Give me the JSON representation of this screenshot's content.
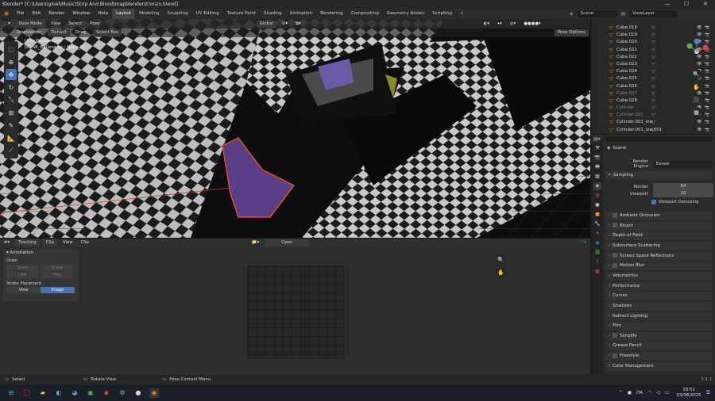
{
  "window": {
    "title": "Blender* [C:\\Users\\gioel\\Music\\Strip And Blood\\mapblenderstronzo.blend]",
    "controls": [
      "—",
      "☐",
      "✕"
    ]
  },
  "menu": {
    "items": [
      "File",
      "Edit",
      "Render",
      "Window",
      "Help"
    ],
    "workspaces": [
      "Layout",
      "Modeling",
      "Sculpting",
      "UV Editing",
      "Texture Paint",
      "Shading",
      "Animation",
      "Rendering",
      "Compositing",
      "Geometry Nodes",
      "Scripting",
      "+"
    ],
    "scene": "Scene",
    "view_layer": "ViewLayer"
  },
  "viewport": {
    "mode": "Pose Mode",
    "menus": [
      "View",
      "Select",
      "Pose"
    ],
    "transform": "Global",
    "orientation_label": "Orientation:",
    "orientation_value": "Default",
    "drag_label": "Drag:",
    "drag_value": "Select Box",
    "pose_options": "Pose Options",
    "perspective": "User Perspective",
    "object_info": "(0) SK_Ballora.ao : Neck_fh"
  },
  "clip": {
    "mode": "Tracking",
    "view_mode": "Clip",
    "menus": [
      "View",
      "Clip"
    ],
    "open": "Open",
    "annotation": {
      "title": "Annotation",
      "draw_label": "Draw:",
      "tools": [
        "Draw",
        "Erase",
        "Line",
        "Poly"
      ],
      "stroke_label": "Stroke Placement:",
      "view": "View",
      "image": "Image"
    }
  },
  "outliner": {
    "items": [
      {
        "name": "Cube.018",
        "dim": false
      },
      {
        "name": "Cube.019",
        "dim": false
      },
      {
        "name": "Cube.020",
        "dim": false
      },
      {
        "name": "Cube.021",
        "dim": false
      },
      {
        "name": "Cube.022",
        "dim": false
      },
      {
        "name": "Cube.023",
        "dim": false
      },
      {
        "name": "Cube.024",
        "dim": false
      },
      {
        "name": "Cube.025",
        "dim": false
      },
      {
        "name": "Cube.026",
        "dim": false
      },
      {
        "name": "Cube.027",
        "dim": true
      },
      {
        "name": "Cube.028",
        "dim": false
      },
      {
        "name": "Cylinder",
        "dim": true
      },
      {
        "name": "Cylinder.001",
        "dim": true
      },
      {
        "name": "Cylinder.001_low",
        "dim": false
      },
      {
        "name": "Cylinder.001_low.001",
        "dim": false
      }
    ]
  },
  "properties": {
    "context": "Scene",
    "render_engine_label": "Render Engine",
    "render_engine": "Eevee",
    "sampling": "Sampling",
    "render_label": "Render",
    "render_value": "64",
    "viewport_label": "Viewport",
    "viewport_value": "16",
    "denoising": "Viewport Denoising",
    "sections": [
      {
        "label": "Ambient Occlusion",
        "check": true
      },
      {
        "label": "Bloom",
        "check": true
      },
      {
        "label": "Depth of Field",
        "check": false
      },
      {
        "label": "Subsurface Scattering",
        "check": false
      },
      {
        "label": "Screen Space Reflections",
        "check": true
      },
      {
        "label": "Motion Blur",
        "check": true
      },
      {
        "label": "Volumetrics",
        "check": false
      },
      {
        "label": "Performance",
        "check": false
      },
      {
        "label": "Curves",
        "check": false
      },
      {
        "label": "Shadows",
        "check": false
      },
      {
        "label": "Indirect Lighting",
        "check": false
      },
      {
        "label": "Film",
        "check": false
      },
      {
        "label": "Simplify",
        "check": true
      },
      {
        "label": "Grease Pencil",
        "check": false
      },
      {
        "label": "Freestyle",
        "check": true
      },
      {
        "label": "Color Management",
        "check": false
      }
    ]
  },
  "status": {
    "select": "Select",
    "rotate": "Rotate View",
    "context": "Pose Context Menu",
    "version": "3.5.1"
  },
  "taskbar": {
    "lang": "ITA",
    "time": "18:51",
    "date": "03/08/2025"
  }
}
